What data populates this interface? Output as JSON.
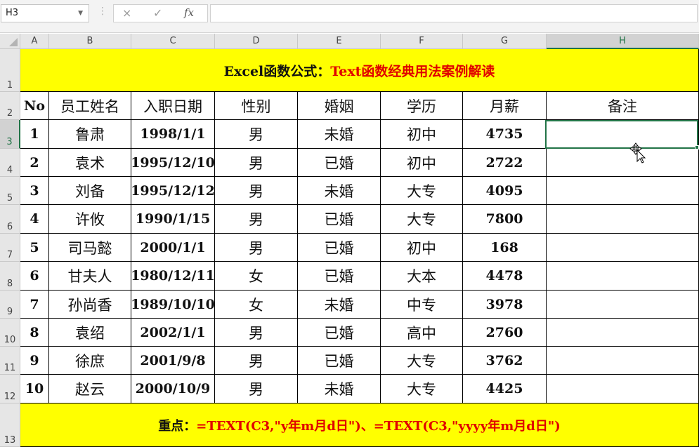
{
  "formula_bar": {
    "name_box": "H3",
    "cancel_icon": "×",
    "enter_icon": "✓",
    "fx_label": "fx",
    "formula": ""
  },
  "grid": {
    "selected_cell": "H3",
    "columns": [
      "A",
      "B",
      "C",
      "D",
      "E",
      "F",
      "G",
      "H"
    ],
    "rows": [
      "1",
      "2",
      "3",
      "4",
      "5",
      "6",
      "7",
      "8",
      "9",
      "10",
      "11",
      "12",
      "13"
    ]
  },
  "sheet": {
    "title": {
      "black": "Excel函数公式：",
      "red": "Text函数经典用法案例解读"
    },
    "headers": [
      "No",
      "员工姓名",
      "入职日期",
      "性别",
      "婚姻",
      "学历",
      "月薪",
      "备注"
    ],
    "records": [
      [
        "1",
        "鲁肃",
        "1998/1/1",
        "男",
        "未婚",
        "初中",
        "4735",
        ""
      ],
      [
        "2",
        "袁术",
        "1995/12/10",
        "男",
        "已婚",
        "初中",
        "2722",
        ""
      ],
      [
        "3",
        "刘备",
        "1995/12/12",
        "男",
        "未婚",
        "大专",
        "4095",
        ""
      ],
      [
        "4",
        "许攸",
        "1990/1/15",
        "男",
        "已婚",
        "大专",
        "7800",
        ""
      ],
      [
        "5",
        "司马懿",
        "2000/1/1",
        "男",
        "已婚",
        "初中",
        "168",
        ""
      ],
      [
        "6",
        "甘夫人",
        "1980/12/11",
        "女",
        "已婚",
        "大本",
        "4478",
        ""
      ],
      [
        "7",
        "孙尚香",
        "1989/10/10",
        "女",
        "未婚",
        "中专",
        "3978",
        ""
      ],
      [
        "8",
        "袁绍",
        "2002/1/1",
        "男",
        "已婚",
        "高中",
        "2760",
        ""
      ],
      [
        "9",
        "徐庶",
        "2001/9/8",
        "男",
        "已婚",
        "大专",
        "3762",
        ""
      ],
      [
        "10",
        "赵云",
        "2000/10/9",
        "男",
        "未婚",
        "大专",
        "4425",
        ""
      ]
    ],
    "note": {
      "black": "重点：",
      "red": "=TEXT(C3,\"y年m月d日\")、=TEXT(C3,\"yyyy年m月d日\")"
    }
  },
  "colors": {
    "banner_bg": "#ffff00",
    "banner_red": "#e00000",
    "selection": "#217346"
  }
}
